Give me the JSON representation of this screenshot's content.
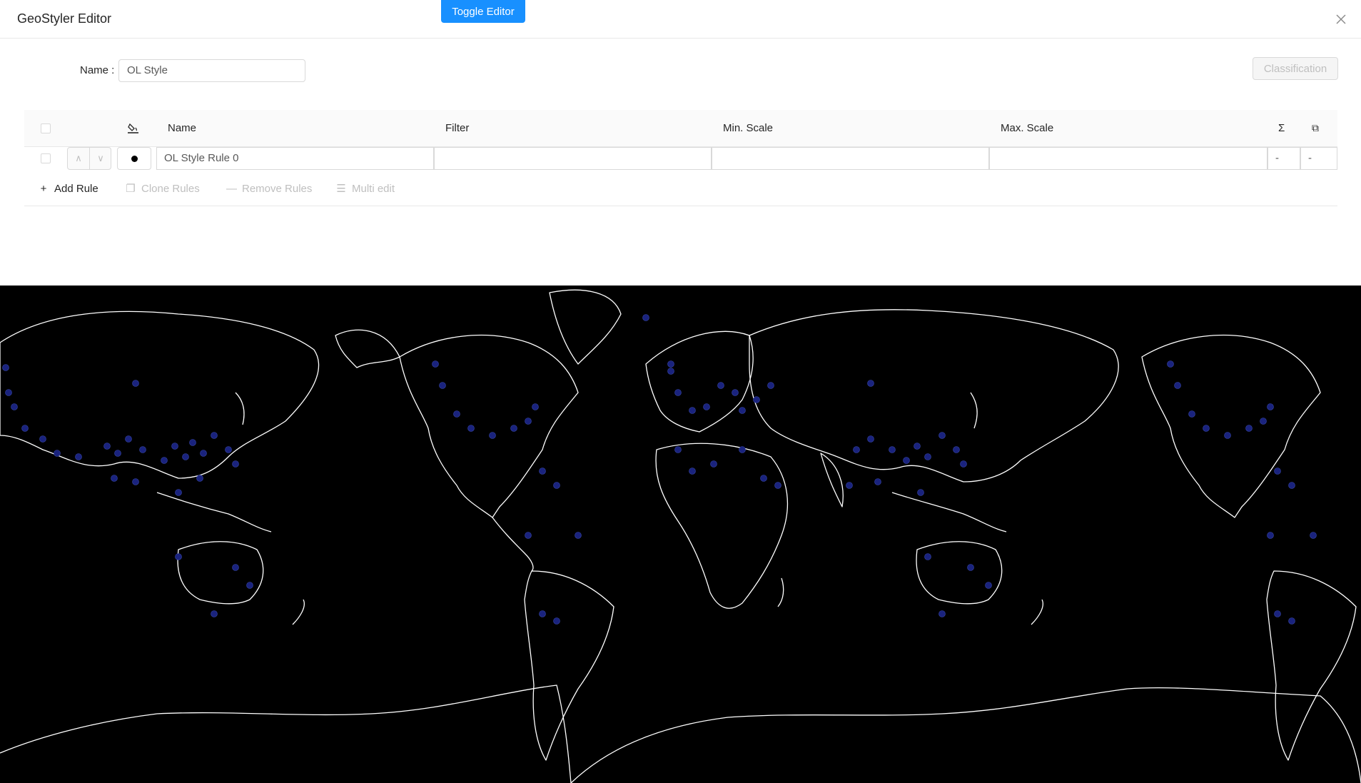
{
  "header": {
    "title": "GeoStyler Editor",
    "toggle_label": "Toggle Editor"
  },
  "style_form": {
    "name_label": "Name",
    "name_value": "OL Style",
    "classification_label": "Classification"
  },
  "rules_table": {
    "columns": {
      "name": "Name",
      "filter": "Filter",
      "min_scale": "Min. Scale",
      "max_scale": "Max. Scale",
      "sum_icon": "Σ",
      "clone_icon": "⧉"
    },
    "rows": [
      {
        "name": "OL Style Rule 0",
        "filter": "",
        "min_scale": "",
        "max_scale": "",
        "count": "-",
        "duplicates": "-"
      }
    ]
  },
  "actions": {
    "add_rule": "Add Rule",
    "clone_rules": "Clone Rules",
    "remove_rules": "Remove Rules",
    "multi_edit": "Multi edit"
  },
  "map": {
    "background_color": "#000000",
    "coastline_color": "#ffffff",
    "point_fill_color": "#1a237e"
  },
  "colors": {
    "primary": "#1890ff",
    "border": "#d9d9d9",
    "disabled_text": "#bfbfbf"
  }
}
